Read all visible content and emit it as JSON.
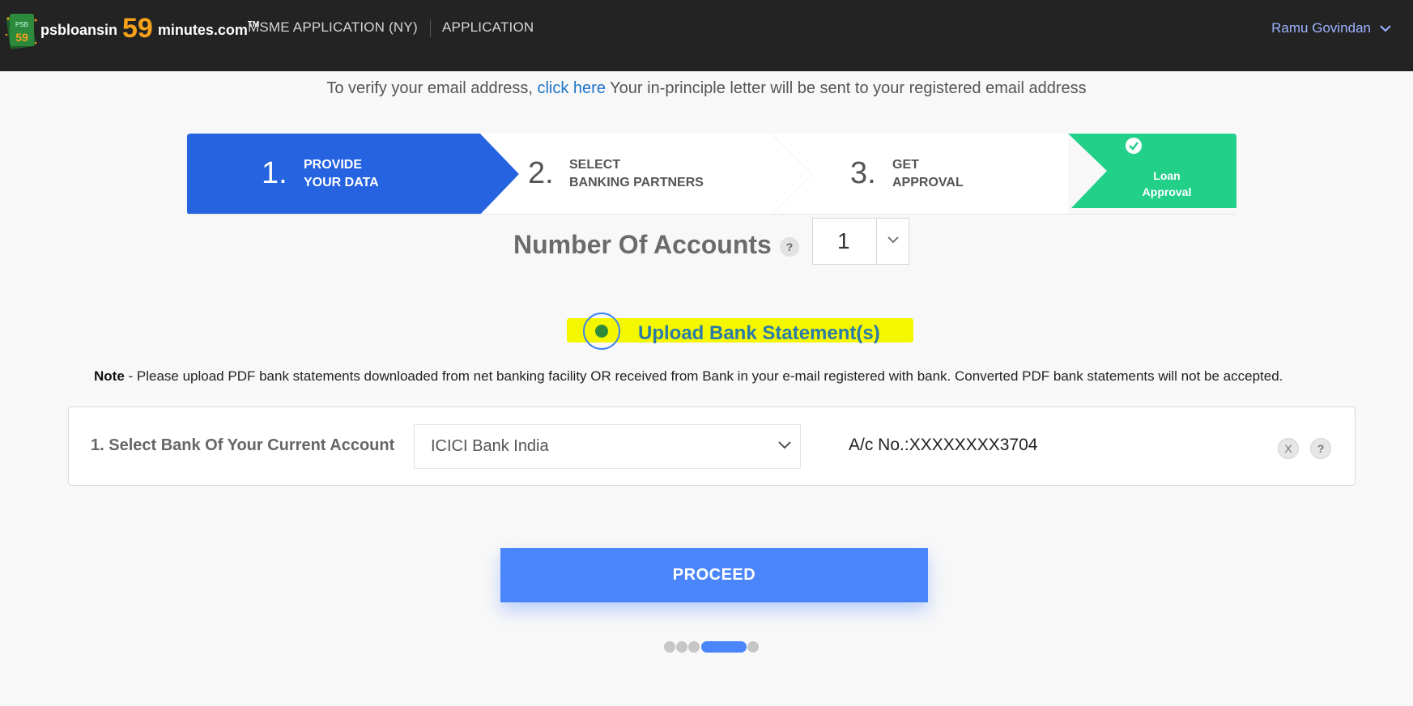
{
  "header": {
    "logo": {
      "prefix": "psbloansin",
      "number": "59",
      "suffix": "minutes.com",
      "tm": "TM",
      "badge": "59",
      "badge_top": "PSB"
    },
    "nav": {
      "msme": "MSME APPLICATION (NY)",
      "application": "APPLICATION"
    },
    "user": "Ramu Govindan"
  },
  "notice": {
    "prefix": "To verify your email address, ",
    "link": "click here",
    "suffix": " Your in-principle letter will be sent to your registered email address"
  },
  "stepper": {
    "steps": [
      {
        "num": "1.",
        "line1": "PROVIDE",
        "line2": "YOUR DATA",
        "active": true
      },
      {
        "num": "2.",
        "line1": "SELECT",
        "line2": "BANKING PARTNERS",
        "active": false
      },
      {
        "num": "3.",
        "line1": "GET",
        "line2": "APPROVAL",
        "active": false
      }
    ],
    "final": {
      "line1": "Loan",
      "line2": "Approval"
    }
  },
  "accounts": {
    "label": "Number Of Accounts",
    "help": "?",
    "value": "1"
  },
  "upload": {
    "label": "Upload Bank Statement(s)",
    "selected": true
  },
  "note": {
    "bold": "Note",
    "text": " - Please upload PDF bank statements downloaded from net banking facility OR received from Bank in your e-mail registered with bank. Converted PDF bank statements will not be accepted."
  },
  "bank": {
    "label": "1. Select Bank Of Your Current Account",
    "selected": "ICICI Bank India",
    "account": "A/c No.:XXXXXXXX3704",
    "remove": "X",
    "help": "?"
  },
  "proceed_label": "PROCEED",
  "pager": {
    "count": 5,
    "active_index": 3
  },
  "colors": {
    "header_bg": "#232323",
    "step_active": "#2563e0",
    "step_final": "#22d08a",
    "primary": "#4a85fb",
    "highlight": "#f5f700"
  }
}
